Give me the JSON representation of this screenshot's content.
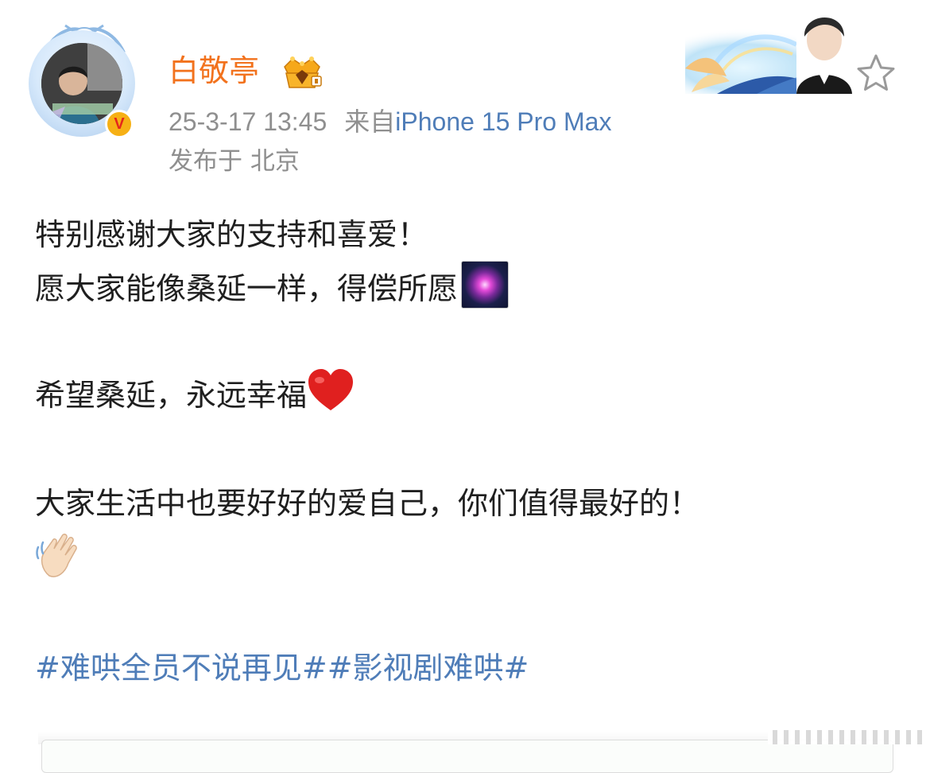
{
  "post": {
    "author": {
      "name": "白敬亭",
      "avatar_icon": "avatar-photo",
      "badge_icon": "crown-icon",
      "verified_letter": "V",
      "verified_color": "#f6b015"
    },
    "meta": {
      "timestamp": "25-3-17 13:45",
      "from_label": "来自",
      "device": "iPhone 15 Pro Max",
      "location": "发布于 北京"
    },
    "content": {
      "line1": "特别感谢大家的支持和喜爱！",
      "line2": "愿大家能像桑延一样，得偿所愿",
      "line2_emoji": "fireworks-emoji",
      "line3": "希望桑延，永远幸福",
      "line3_emoji": "red-heart-emoji",
      "line4": "大家生活中也要好好的爱自己，你们值得最好的！",
      "line5_emoji": "waving-hand-emoji"
    },
    "hashtags": [
      "#难哄全员不说再见#",
      "#影视剧难哄#"
    ],
    "colors": {
      "username": "#f2721d",
      "link": "#4f7db8",
      "meta": "#8f8f8f",
      "text": "#1f1f1f"
    }
  },
  "actions": {
    "favorite_icon": "star-icon"
  }
}
